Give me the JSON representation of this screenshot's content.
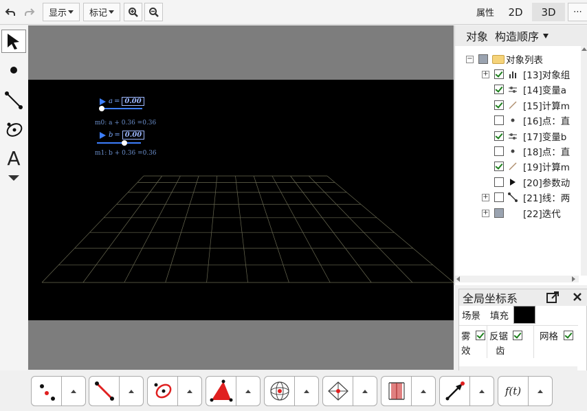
{
  "toolbar": {
    "undo_icon": "undo-icon",
    "redo_icon": "redo-icon",
    "display_label": "显示",
    "mark_label": "标记",
    "zoom_in_icon": "zoom-in-icon",
    "zoom_out_icon": "zoom-out-icon",
    "properties_tab": "属性",
    "tab_2d": "2D",
    "tab_3d": "3D",
    "more_label": "⋯"
  },
  "graphics": {
    "slider_a": {
      "var": "a",
      "eq": "=",
      "value": "0.00"
    },
    "slider_b": {
      "var": "b",
      "eq": "=",
      "value": "0.00"
    },
    "calc_m0": "m0: a + 0.36 =0.36",
    "calc_m1": "m1: b + 0.36 =0.36"
  },
  "object_panel": {
    "header_objects": "对象",
    "header_order": "构造顺序",
    "root_label": "对象列表",
    "items": [
      {
        "label": "[13]对象组",
        "checked": true,
        "expandable": true
      },
      {
        "label": "[14]变量a",
        "checked": true,
        "expandable": false
      },
      {
        "label": "[15]计算m",
        "checked": true,
        "expandable": false
      },
      {
        "label": "[16]点：直",
        "checked": false,
        "expandable": false
      },
      {
        "label": "[17]变量b",
        "checked": true,
        "expandable": false
      },
      {
        "label": "[18]点：直",
        "checked": false,
        "expandable": false
      },
      {
        "label": "[19]计算m",
        "checked": true,
        "expandable": false
      },
      {
        "label": "[20]参数动",
        "checked": false,
        "expandable": false
      },
      {
        "label": "[21]线：两",
        "checked": false,
        "expandable": true
      },
      {
        "label": "[22]迭代",
        "checked": null,
        "expandable": true
      }
    ]
  },
  "properties_panel": {
    "title": "全局坐标系",
    "scene_label": "场景",
    "fill_label": "填充",
    "fill_color": "#000000",
    "fog_label_1": "雾",
    "fog_label_2": "效",
    "fog_checked": true,
    "antialias_label_1": "反锯",
    "antialias_label_2": "齿",
    "antialias_checked": true,
    "grid_label": "网格",
    "grid_checked": true
  },
  "bottom_tools": [
    "point-tool-icon",
    "line-tool-icon",
    "circle-tool-icon",
    "polygon-tool-icon",
    "sphere-tool-icon",
    "intersect-tool-icon",
    "prism-tool-icon",
    "vector-tool-icon",
    "function-tool-icon"
  ],
  "bottom_function_label": "f(t)",
  "left_text_tool": "A"
}
